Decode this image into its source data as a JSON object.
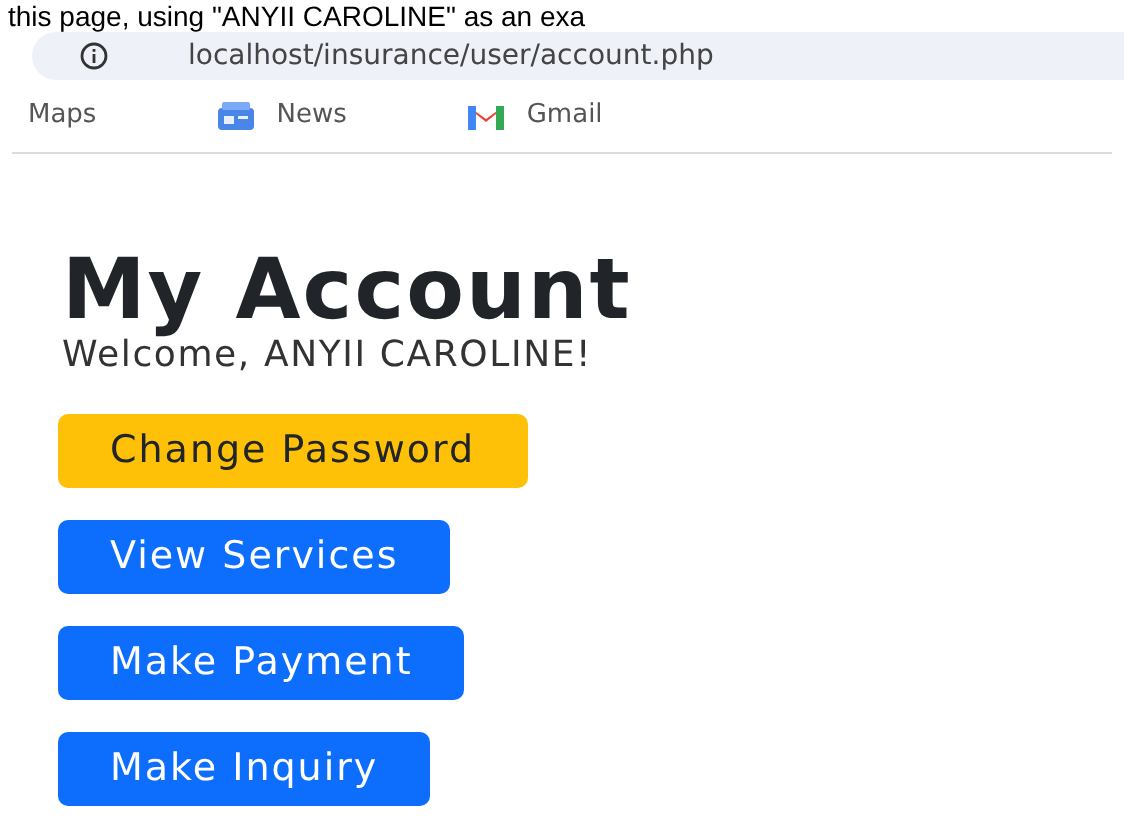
{
  "document_caption": "this page, using \"ANYII CAROLINE\" as an exa",
  "address_bar": {
    "url": "localhost/insurance/user/account.php"
  },
  "bookmarks": [
    {
      "label": "Maps",
      "kind": "plain"
    },
    {
      "label": "News",
      "kind": "news"
    },
    {
      "label": "Gmail",
      "kind": "gmail"
    }
  ],
  "page": {
    "title": "My Account",
    "welcome": "Welcome, ANYII CAROLINE!",
    "buttons": [
      {
        "label": "Change Password",
        "kind": "warning"
      },
      {
        "label": "View Services",
        "kind": "primary"
      },
      {
        "label": "Make Payment",
        "kind": "primary"
      },
      {
        "label": "Make Inquiry",
        "kind": "primary"
      }
    ]
  }
}
